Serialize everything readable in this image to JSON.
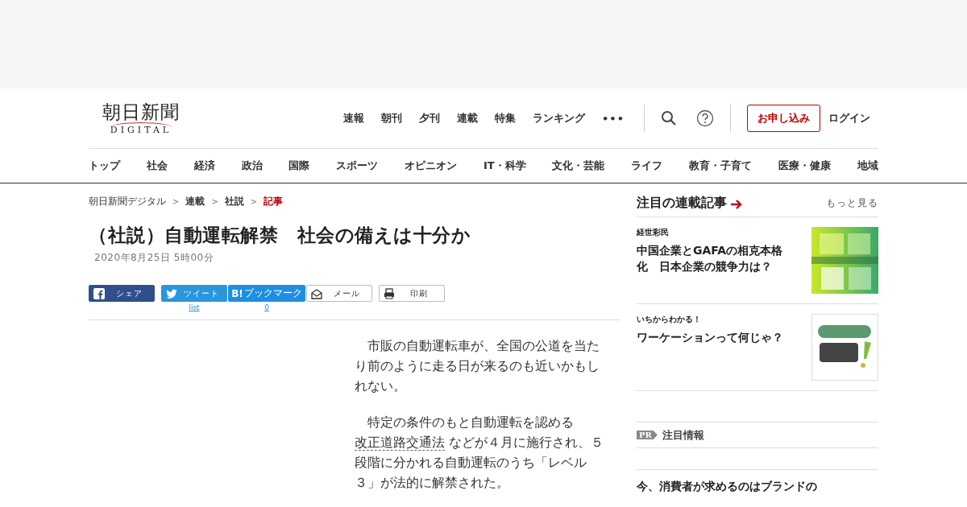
{
  "header": {
    "logo": {
      "title": "朝日新聞",
      "subtitle": "DIGITAL"
    },
    "top_nav": [
      "速報",
      "朝刊",
      "夕刊",
      "連載",
      "特集",
      "ランキング"
    ],
    "more": "•••",
    "apply_button": "お申し込み",
    "login": "ログイン",
    "categories": [
      "トップ",
      "社会",
      "経済",
      "政治",
      "国際",
      "スポーツ",
      "オピニオン",
      "IT・科学",
      "文化・芸能",
      "ライフ",
      "教育・子育て",
      "医療・健康",
      "地域"
    ]
  },
  "breadcrumbs": [
    {
      "label": "朝日新聞デジタル",
      "current": false,
      "bold": false
    },
    {
      "label": "連載",
      "current": false,
      "bold": true
    },
    {
      "label": "社説",
      "current": false,
      "bold": true
    },
    {
      "label": "記事",
      "current": true,
      "bold": true
    }
  ],
  "breadcrumb_separator": ">",
  "article": {
    "title": "（社説）自動運転解禁　社会の備えは十分か",
    "date": "2020年8月25日 5時00分",
    "share": [
      {
        "kind": "facebook",
        "label": "シェア"
      },
      {
        "kind": "twitter",
        "label": "ツイート",
        "count": "list"
      },
      {
        "kind": "hatena",
        "label": "ブックマーク",
        "icon_text": "B!",
        "count": "0"
      },
      {
        "kind": "mail",
        "label": "メール"
      },
      {
        "kind": "print",
        "label": "印刷"
      }
    ],
    "paragraphs": [
      [
        {
          "kind": "text",
          "text": "　市販の自動運転車が、全国の公道を当たり前のように走る日が来るのも近いかもしれない。"
        }
      ],
      [
        {
          "kind": "text",
          "text": "　特定の条件のもと自動運転を認める "
        },
        {
          "kind": "link",
          "text": "改正道路交通法"
        },
        {
          "kind": "text",
          "text": " などが４月に施行され、５段階に分かれる自動運転のうち「レベル３」が法的に解禁された。"
        }
      ]
    ]
  },
  "sidebar": {
    "title": "注目の連載記事",
    "more": "もっと見る",
    "articles": [
      {
        "series": "経世彩民",
        "title": "中国企業とGAFAの相克本格化　日本企業の競争力は？"
      },
      {
        "series": "いちからわかる！",
        "title": "ワーケーションって何じゃ？"
      }
    ],
    "pr": {
      "badge": "PR",
      "title": "注目情報"
    },
    "promo": "今、消費者が求めるのはブランドの"
  }
}
